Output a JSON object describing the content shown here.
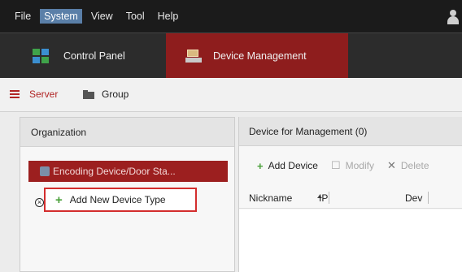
{
  "menubar": {
    "items": [
      {
        "label": "File",
        "active": false
      },
      {
        "label": "System",
        "active": true
      },
      {
        "label": "View",
        "active": false
      },
      {
        "label": "Tool",
        "active": false
      },
      {
        "label": "Help",
        "active": false
      }
    ],
    "user_icon": "user-icon"
  },
  "modules": {
    "control_panel": {
      "label": "Control Panel",
      "icon": "grid-icon"
    },
    "device_management": {
      "label": "Device Management",
      "icon": "device-icon"
    }
  },
  "subtabs": {
    "server": {
      "label": "Server",
      "icon": "server-list-icon"
    },
    "group": {
      "label": "Group",
      "icon": "folder-icon"
    }
  },
  "organization": {
    "title": "Organization",
    "items": [
      {
        "label": "Encoding Device/Door Sta...",
        "icon": "encoder-icon",
        "selected": true
      }
    ],
    "add_type_label": "Add New Device Type",
    "close_icon": "close-circle-icon"
  },
  "devices": {
    "title": "Device for Management (0)",
    "toolbar": {
      "add": "Add Device",
      "modify": "Modify",
      "delete": "Delete"
    },
    "columns": [
      "Nickname",
      "IP",
      "Dev"
    ],
    "rows": []
  },
  "colors": {
    "menubar_bg": "#1b1b1b",
    "module_active": "#8e1d1d",
    "accent_red": "#b12424",
    "highlight_border": "#d32d2d"
  }
}
